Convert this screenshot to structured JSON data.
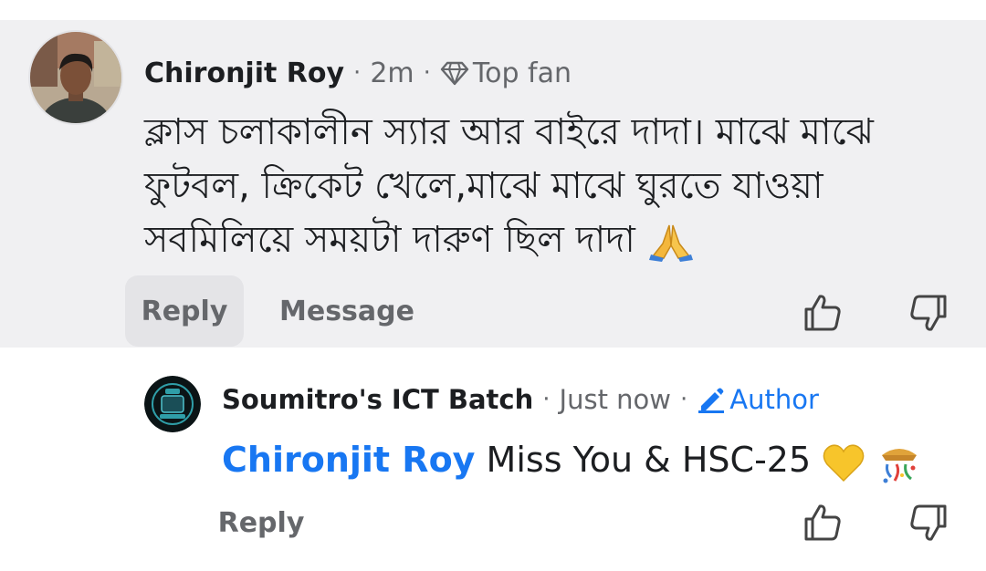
{
  "comment": {
    "author": "Chironjit Roy",
    "time": "2m",
    "badge": "Top fan",
    "text_lines": [
      "ক্লাস চলাকালীন স্যার আর বাইরে দাদা। মাঝে মাঝে",
      "ফুটবল, ক্রিকেট খেলে,মাঝে মাঝে ঘুরতে যাওয়া",
      "সবমিলিয়ে সময়টা দারুণ ছিল দাদা"
    ],
    "emoji": "folded-hands",
    "actions": {
      "reply": "Reply",
      "message": "Message"
    }
  },
  "reply": {
    "author": "Soumitro's ICT Batch",
    "time": "Just now",
    "badge": "Author",
    "mention": "Chironjit Roy",
    "text": "Miss You & HSC-25",
    "emojis": [
      "yellow-heart",
      "confetti-ball"
    ],
    "actions": {
      "reply": "Reply"
    }
  },
  "colors": {
    "comment_bg": "#f0f0f2",
    "accent": "#1877f2",
    "muted": "#65676b"
  }
}
